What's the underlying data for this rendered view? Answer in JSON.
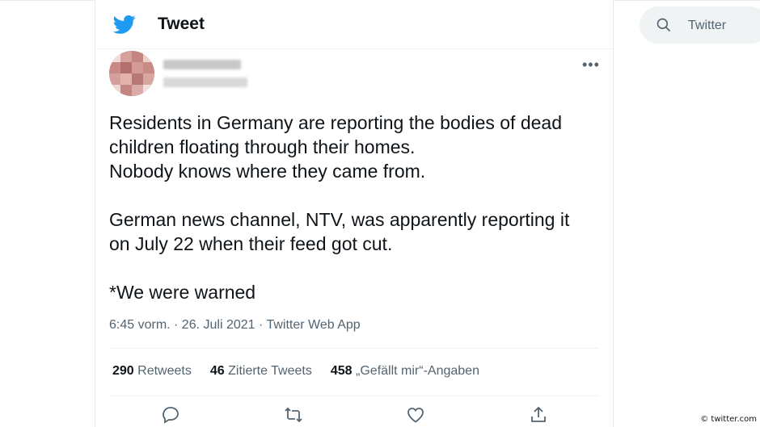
{
  "header": {
    "title": "Tweet",
    "logo": "twitter-bird-icon",
    "accent": "#1d9bf0"
  },
  "author": {
    "avatar": "avatar",
    "name_blurred": true,
    "handle_blurred": true
  },
  "tweet": {
    "lines_1": [
      "Residents in Germany are reporting the bodies of dead",
      "children floating through their homes.",
      "Nobody knows where they came from."
    ],
    "lines_2": [
      "German news channel, NTV, was apparently reporting it",
      "on July 22 when their feed got cut."
    ],
    "lines_3": [
      "*We were warned"
    ],
    "meta": "6:45 vorm. · 26. Juli 2021 · Twitter Web App"
  },
  "stats": [
    {
      "count": "290",
      "label": "Retweets"
    },
    {
      "count": "46",
      "label": "Zitierte Tweets"
    },
    {
      "count": "458",
      "label": "„Gefällt mir“-Angaben"
    }
  ],
  "actions": [
    "reply-icon",
    "retweet-icon",
    "like-icon",
    "share-icon"
  ],
  "search": {
    "placeholder": "Twitter"
  },
  "credit": "© twitter.com"
}
